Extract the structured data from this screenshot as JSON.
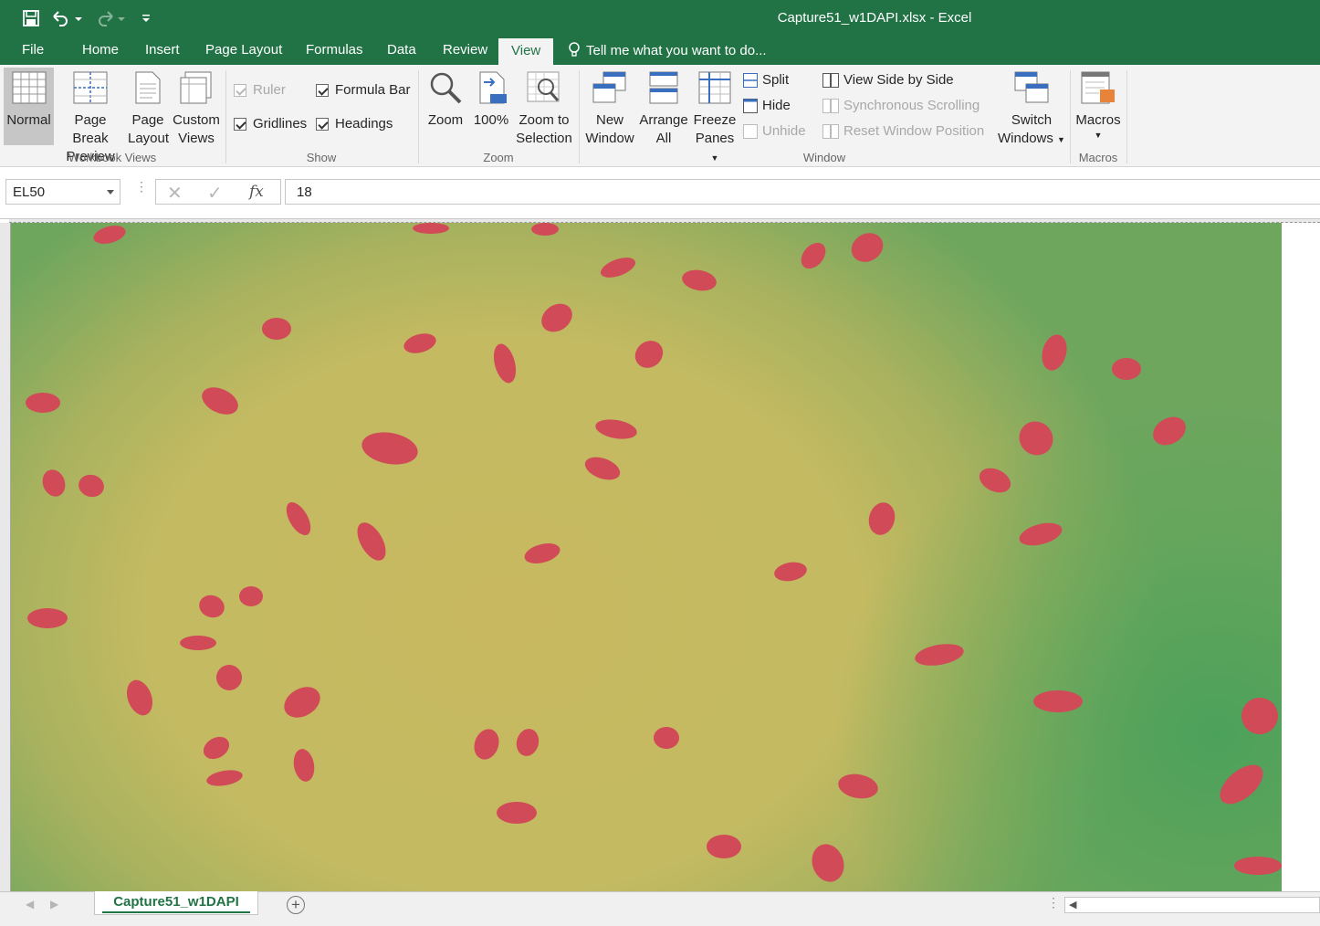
{
  "window": {
    "title": "Capture51_w1DAPI.xlsx - Excel",
    "accent": "#217346"
  },
  "qat": {
    "save_icon": "save-icon",
    "undo_icon": "undo-icon",
    "redo_icon": "redo-icon",
    "customize_icon": "customize-qat-icon"
  },
  "tabs": [
    {
      "label": "File"
    },
    {
      "label": "Home"
    },
    {
      "label": "Insert"
    },
    {
      "label": "Page Layout"
    },
    {
      "label": "Formulas"
    },
    {
      "label": "Data"
    },
    {
      "label": "Review"
    },
    {
      "label": "View"
    }
  ],
  "active_tab": "View",
  "tell_me": "Tell me what you want to do...",
  "ribbon": {
    "workbook_views": {
      "label": "Workbook Views",
      "normal": "Normal",
      "page_break_1": "Page Break",
      "page_break_2": "Preview",
      "page_layout_1": "Page",
      "page_layout_2": "Layout",
      "custom_1": "Custom",
      "custom_2": "Views"
    },
    "show": {
      "label": "Show",
      "ruler": "Ruler",
      "formula_bar": "Formula Bar",
      "gridlines": "Gridlines",
      "headings": "Headings"
    },
    "zoom": {
      "label": "Zoom",
      "zoom": "Zoom",
      "hundred": "100%",
      "zts_1": "Zoom to",
      "zts_2": "Selection",
      "badge": "100"
    },
    "window": {
      "label": "Window",
      "new_1": "New",
      "new_2": "Window",
      "arrange_1": "Arrange",
      "arrange_2": "All",
      "freeze_1": "Freeze",
      "freeze_2": "Panes",
      "split": "Split",
      "hide": "Hide",
      "unhide": "Unhide",
      "side_by_side": "View Side by Side",
      "sync_scroll": "Synchronous Scrolling",
      "reset_pos": "Reset Window Position",
      "switch_1": "Switch",
      "switch_2": "Windows"
    },
    "macros": {
      "label": "Macros",
      "macros": "Macros"
    }
  },
  "formula_bar": {
    "name_box": "EL50",
    "fx": "fx",
    "value": "18"
  },
  "sheet": {
    "tab": "Capture51_w1DAPI"
  }
}
